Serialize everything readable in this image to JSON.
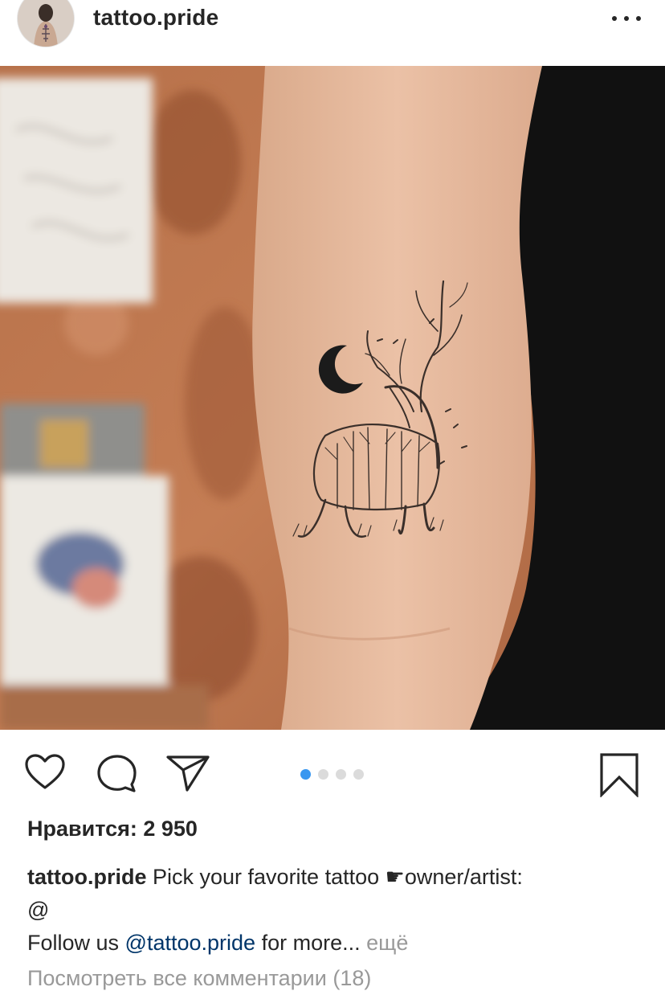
{
  "post": {
    "username": "tattoo.pride",
    "more_icon": "more-horizontal-icon"
  },
  "actions": {
    "like_icon": "heart-icon",
    "comment_icon": "comment-icon",
    "share_icon": "send-icon",
    "save_icon": "bookmark-icon",
    "carousel": {
      "total": 4,
      "active": 1
    }
  },
  "likes": {
    "label": "Нравится: 2 950"
  },
  "caption": {
    "author": "tattoo.pride",
    "line1_text": " Pick your favorite tattoo ☛owner/artist:",
    "line2_text": "@",
    "line3_prefix": "Follow us ",
    "mention": "@tattoo.pride",
    "line3_suffix": " for more...",
    "more_label": "ещё"
  },
  "comments": {
    "view_all_label": "Посмотреть все комментарии (18)"
  },
  "colors": {
    "accent": "#3897f0",
    "mention": "#003569",
    "muted": "#999999",
    "text": "#262626"
  }
}
